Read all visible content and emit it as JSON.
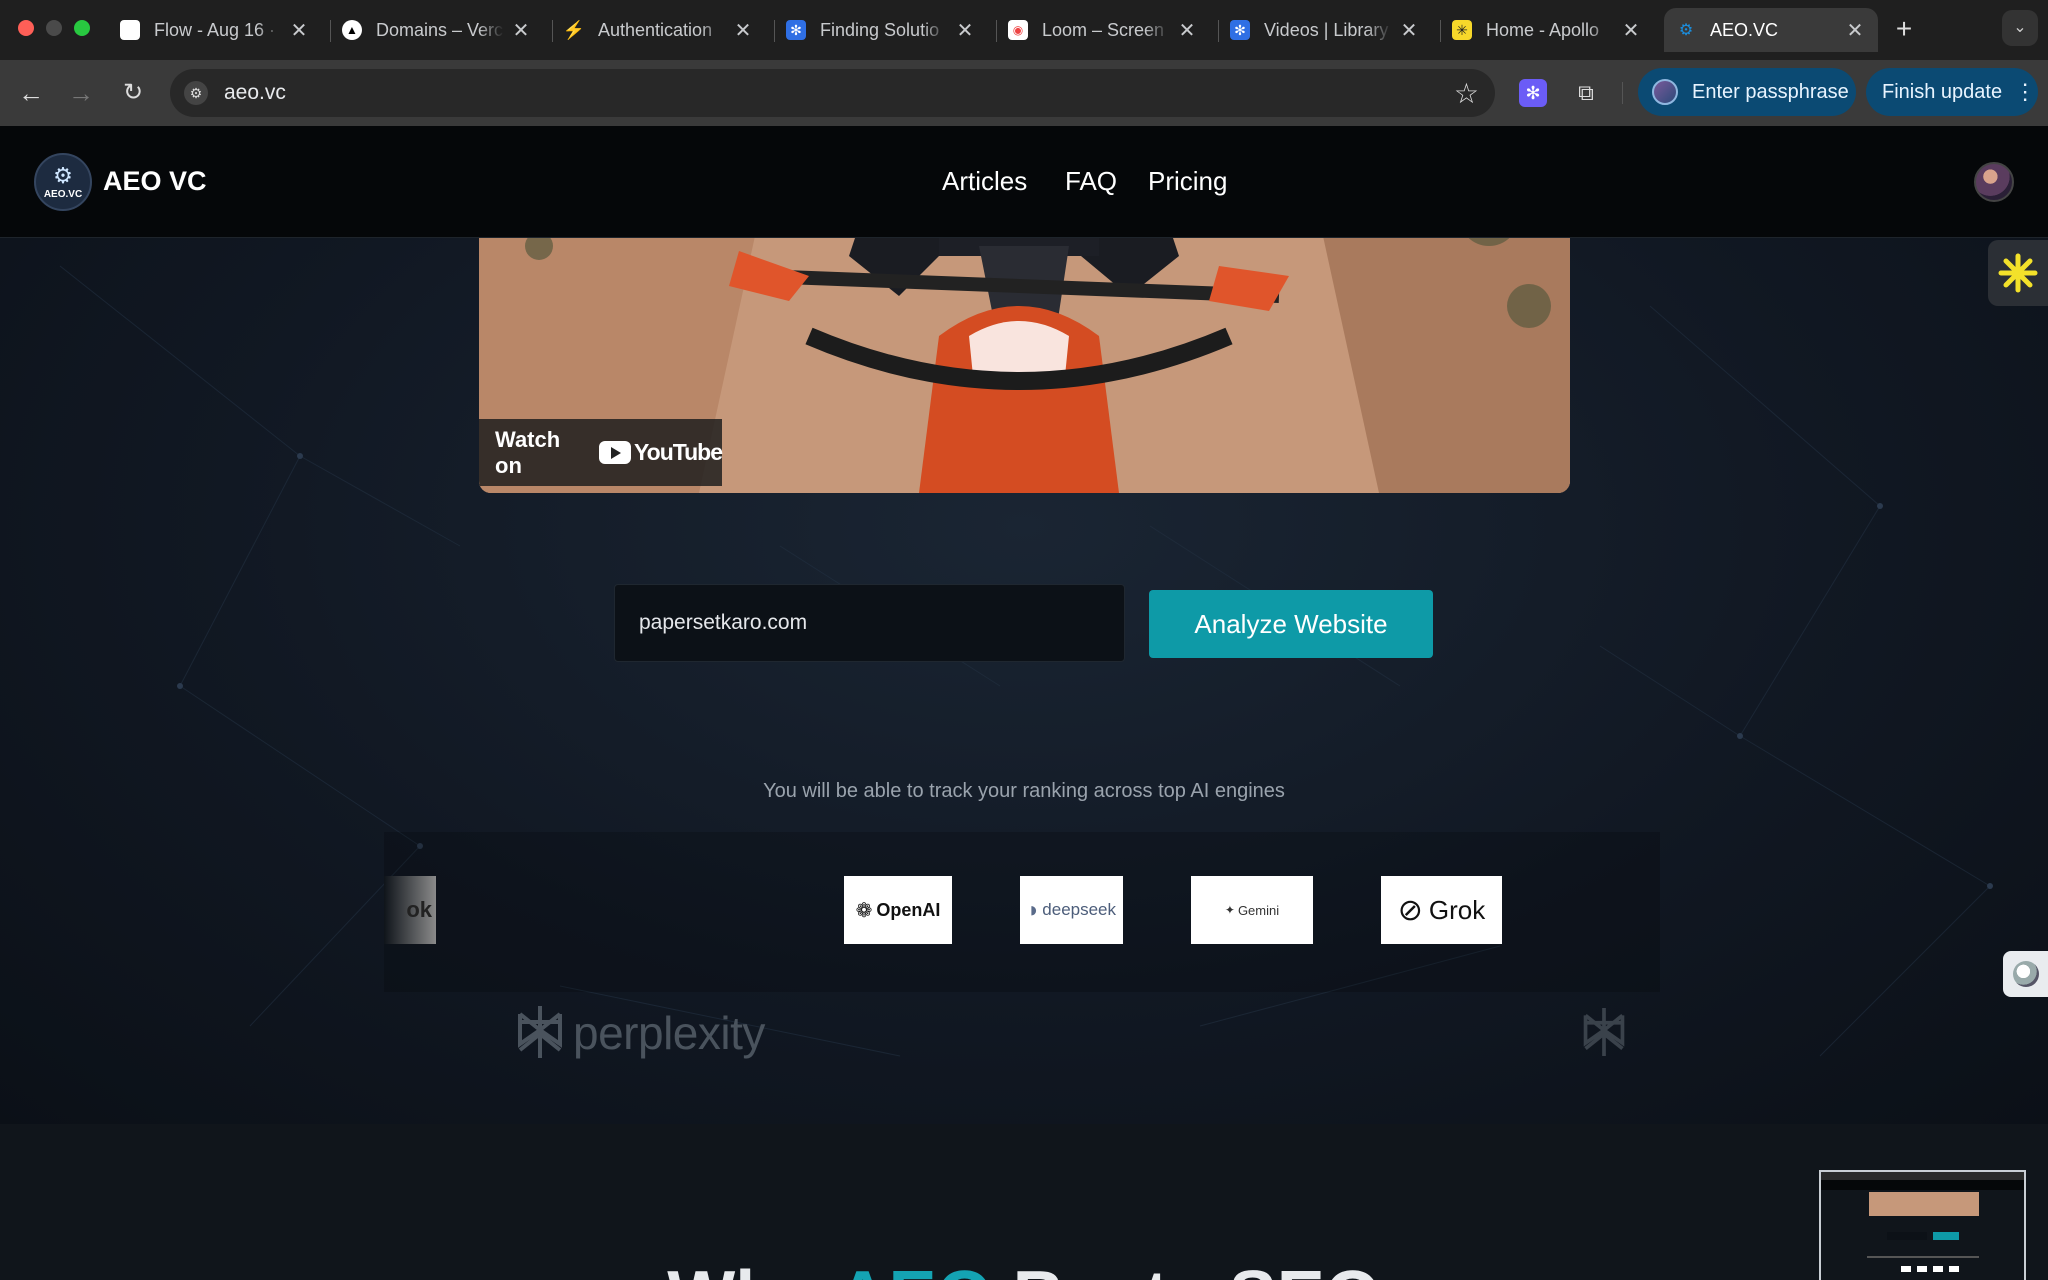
{
  "browser": {
    "tabs": [
      {
        "title": "Flow - Aug 16 ·",
        "favicon_color": "#ffffff"
      },
      {
        "title": "Domains – Verc",
        "favicon_color": "#000000"
      },
      {
        "title": "Authentication",
        "favicon_color": "#3ecf8e"
      },
      {
        "title": "Finding Solutio",
        "favicon_color": "#2f6fe4"
      },
      {
        "title": "Loom – Screen",
        "favicon_color": "#ffffff"
      },
      {
        "title": "Videos | Library",
        "favicon_color": "#2f6fe4"
      },
      {
        "title": "Home - Apollo",
        "favicon_color": "#f7d82a"
      },
      {
        "title": "AEO.VC",
        "favicon_color": "#1a8fe0",
        "active": true
      }
    ],
    "address": "aeo.vc",
    "passphrase_button": "Enter passphrase",
    "update_button": "Finish update"
  },
  "site": {
    "brand": "AEO VC",
    "logo_text": "AEO.VC",
    "nav": [
      "Articles",
      "FAQ",
      "Pricing"
    ]
  },
  "video": {
    "watch_on": "Watch on",
    "youtube": "YouTube"
  },
  "form": {
    "url_value": "papersetkaro.com",
    "analyze_button": "Analyze Website"
  },
  "engines": {
    "caption": "You will be able to track your ranking across top AI engines",
    "partial_left": "ok",
    "items": [
      "perplexity",
      "OpenAI",
      "deepseek",
      "Gemini",
      "Grok"
    ]
  },
  "lower": {
    "heading_start": "Why ",
    "heading_accent": "AEO",
    "heading_end": " Beats SEO"
  },
  "colors": {
    "accent": "#0e9aa7",
    "header_bg": "#050709",
    "page_bg": "#10151b"
  }
}
